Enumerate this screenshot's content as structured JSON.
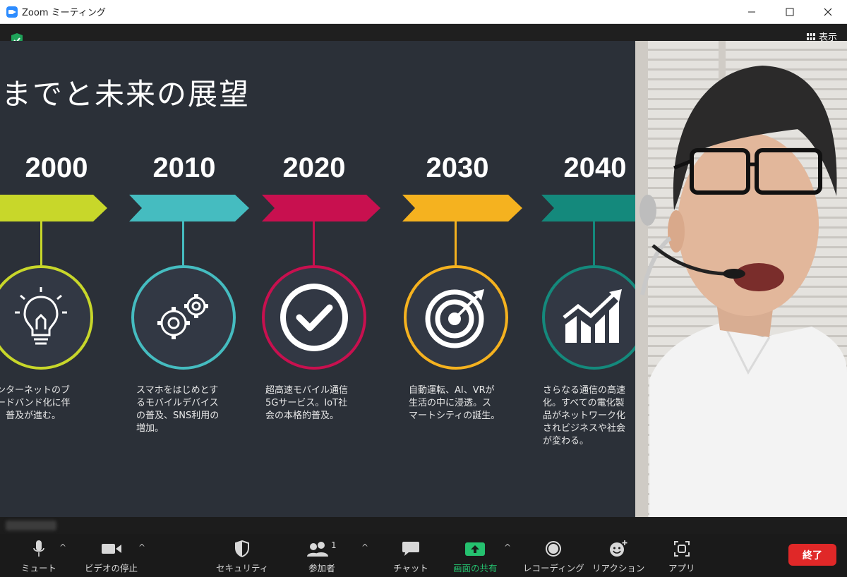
{
  "window": {
    "title": "Zoom ミーティング"
  },
  "meeting": {
    "view_label": "表示"
  },
  "slide": {
    "title": "れまでと未来の展望",
    "timeline": [
      {
        "year": "2000",
        "color": "#c8d72a",
        "icon": "lightbulb-icon",
        "lines": [
          "インターネットのブ",
          "ロードバンド化に伴",
          "い、普及が進む。"
        ]
      },
      {
        "year": "2010",
        "color": "#45bcc0",
        "icon": "gears-icon",
        "lines": [
          "スマホをはじめとす",
          "るモバイルデバイス",
          "の普及、SNS利用の",
          "増加。"
        ]
      },
      {
        "year": "2020",
        "color": "#c8104f",
        "icon": "checkmark-icon",
        "lines": [
          "超高速モバイル通信",
          "5Gサービス。IoT社",
          "会の本格的普及。"
        ]
      },
      {
        "year": "2030",
        "color": "#f5b21f",
        "icon": "target-icon",
        "lines": [
          "自動運転、AI、VRが",
          "生活の中に浸透。ス",
          "マートシティの誕生。"
        ]
      },
      {
        "year": "2040",
        "color": "#14897c",
        "icon": "growth-chart-icon",
        "lines": [
          "さらなる通信の高速",
          "化。すべての電化製",
          "品がネットワーク化",
          "されビジネスや社会",
          "が変わる。"
        ]
      }
    ]
  },
  "toolbar": {
    "mute": "ミュート",
    "video": "ビデオの停止",
    "security": "セキュリティ",
    "participants": "参加者",
    "participants_count": "1",
    "chat": "チャット",
    "share": "画面の共有",
    "record": "レコーディング",
    "reactions": "リアクション",
    "apps": "アプリ",
    "end": "終了"
  },
  "colors": {
    "share_green": "#25c16f",
    "end_red": "#e02828"
  }
}
